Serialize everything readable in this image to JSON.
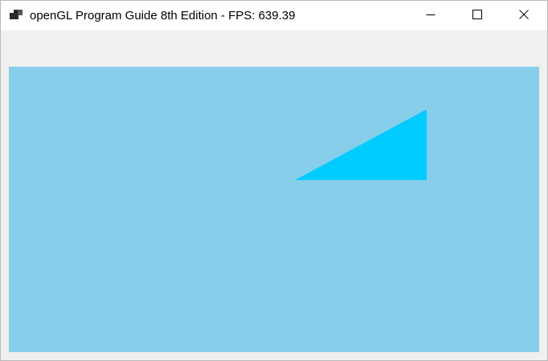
{
  "window": {
    "title": "openGL Program Guide 8th Edition - FPS: 639.39",
    "app_icon": "application-window-icon",
    "controls": {
      "minimize_icon": "minimize-icon",
      "maximize_icon": "maximize-icon",
      "close_icon": "close-icon"
    }
  },
  "viewport": {
    "clear_color": "#87ceeb",
    "shape": "triangle",
    "shape_color": "#00ccff"
  },
  "colors": {
    "titlebar": "#ffffff",
    "client_background": "#f0f0f0"
  }
}
